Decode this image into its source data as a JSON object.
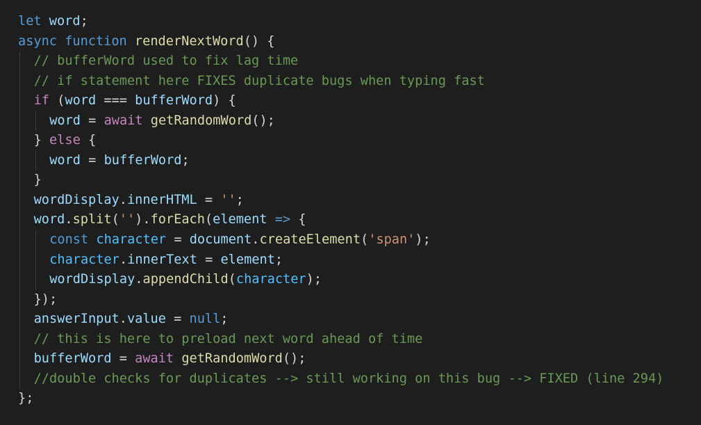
{
  "colors": {
    "background": "#1e1e1e",
    "keyword": "#569cd6",
    "control": "#c586c0",
    "function": "#dcdcaa",
    "variable": "#9cdcfe",
    "constant": "#4fc1ff",
    "string": "#ce9178",
    "comment": "#6a9955",
    "punctuation": "#d4d4d4",
    "indent_guide": "#404040"
  },
  "code": {
    "lines": [
      {
        "indent": 0,
        "tokens": [
          [
            "let",
            "keyword"
          ],
          [
            " ",
            "punctuation"
          ],
          [
            "word",
            "variable"
          ],
          [
            ";",
            "punctuation"
          ]
        ]
      },
      {
        "indent": 0,
        "tokens": [
          [
            "async",
            "keyword"
          ],
          [
            " ",
            "punctuation"
          ],
          [
            "function",
            "keyword"
          ],
          [
            " ",
            "punctuation"
          ],
          [
            "renderNextWord",
            "function"
          ],
          [
            "() {",
            "punctuation"
          ]
        ]
      },
      {
        "indent": 1,
        "tokens": [
          [
            "// bufferWord used to fix lag time",
            "comment"
          ]
        ]
      },
      {
        "indent": 1,
        "tokens": [
          [
            "// if statement here FIXES duplicate bugs when typing fast",
            "comment"
          ]
        ]
      },
      {
        "indent": 1,
        "tokens": [
          [
            "if",
            "control"
          ],
          [
            " (",
            "punctuation"
          ],
          [
            "word",
            "variable"
          ],
          [
            " === ",
            "punctuation"
          ],
          [
            "bufferWord",
            "variable"
          ],
          [
            ") {",
            "punctuation"
          ]
        ]
      },
      {
        "indent": 2,
        "tokens": [
          [
            "word",
            "variable"
          ],
          [
            " = ",
            "punctuation"
          ],
          [
            "await",
            "control"
          ],
          [
            " ",
            "punctuation"
          ],
          [
            "getRandomWord",
            "function"
          ],
          [
            "();",
            "punctuation"
          ]
        ]
      },
      {
        "indent": 1,
        "tokens": [
          [
            "} ",
            "punctuation"
          ],
          [
            "else",
            "control"
          ],
          [
            " {",
            "punctuation"
          ]
        ]
      },
      {
        "indent": 2,
        "tokens": [
          [
            "word",
            "variable"
          ],
          [
            " = ",
            "punctuation"
          ],
          [
            "bufferWord",
            "variable"
          ],
          [
            ";",
            "punctuation"
          ]
        ]
      },
      {
        "indent": 1,
        "tokens": [
          [
            "}",
            "punctuation"
          ]
        ]
      },
      {
        "indent": 1,
        "tokens": [
          [
            "wordDisplay",
            "variable"
          ],
          [
            ".",
            "punctuation"
          ],
          [
            "innerHTML",
            "variable"
          ],
          [
            " = ",
            "punctuation"
          ],
          [
            "''",
            "string"
          ],
          [
            ";",
            "punctuation"
          ]
        ]
      },
      {
        "indent": 1,
        "tokens": [
          [
            "word",
            "variable"
          ],
          [
            ".",
            "punctuation"
          ],
          [
            "split",
            "function"
          ],
          [
            "(",
            "punctuation"
          ],
          [
            "''",
            "string"
          ],
          [
            ").",
            "punctuation"
          ],
          [
            "forEach",
            "function"
          ],
          [
            "(",
            "punctuation"
          ],
          [
            "element",
            "variable"
          ],
          [
            " ",
            "punctuation"
          ],
          [
            "=>",
            "keyword"
          ],
          [
            " {",
            "punctuation"
          ]
        ]
      },
      {
        "indent": 2,
        "tokens": [
          [
            "const",
            "keyword"
          ],
          [
            " ",
            "punctuation"
          ],
          [
            "character",
            "constant"
          ],
          [
            " = ",
            "punctuation"
          ],
          [
            "document",
            "variable"
          ],
          [
            ".",
            "punctuation"
          ],
          [
            "createElement",
            "function"
          ],
          [
            "(",
            "punctuation"
          ],
          [
            "'span'",
            "string"
          ],
          [
            ");",
            "punctuation"
          ]
        ]
      },
      {
        "indent": 2,
        "tokens": [
          [
            "character",
            "constant"
          ],
          [
            ".",
            "punctuation"
          ],
          [
            "innerText",
            "variable"
          ],
          [
            " = ",
            "punctuation"
          ],
          [
            "element",
            "variable"
          ],
          [
            ";",
            "punctuation"
          ]
        ]
      },
      {
        "indent": 2,
        "tokens": [
          [
            "wordDisplay",
            "variable"
          ],
          [
            ".",
            "punctuation"
          ],
          [
            "appendChild",
            "function"
          ],
          [
            "(",
            "punctuation"
          ],
          [
            "character",
            "constant"
          ],
          [
            ");",
            "punctuation"
          ]
        ]
      },
      {
        "indent": 1,
        "tokens": [
          [
            "});",
            "punctuation"
          ]
        ]
      },
      {
        "indent": 1,
        "tokens": [
          [
            "answerInput",
            "variable"
          ],
          [
            ".",
            "punctuation"
          ],
          [
            "value",
            "variable"
          ],
          [
            " = ",
            "punctuation"
          ],
          [
            "null",
            "keyword"
          ],
          [
            ";",
            "punctuation"
          ]
        ]
      },
      {
        "indent": 1,
        "tokens": [
          [
            "// this is here to preload next word ahead of time",
            "comment"
          ]
        ]
      },
      {
        "indent": 1,
        "tokens": [
          [
            "bufferWord",
            "variable"
          ],
          [
            " = ",
            "punctuation"
          ],
          [
            "await",
            "control"
          ],
          [
            " ",
            "punctuation"
          ],
          [
            "getRandomWord",
            "function"
          ],
          [
            "();",
            "punctuation"
          ]
        ]
      },
      {
        "indent": 1,
        "tokens": [
          [
            "//double checks for duplicates --> still working on this bug --> FIXED (line 294)",
            "comment"
          ]
        ]
      },
      {
        "indent": 0,
        "tokens": [
          [
            "};",
            "punctuation"
          ]
        ]
      }
    ]
  }
}
